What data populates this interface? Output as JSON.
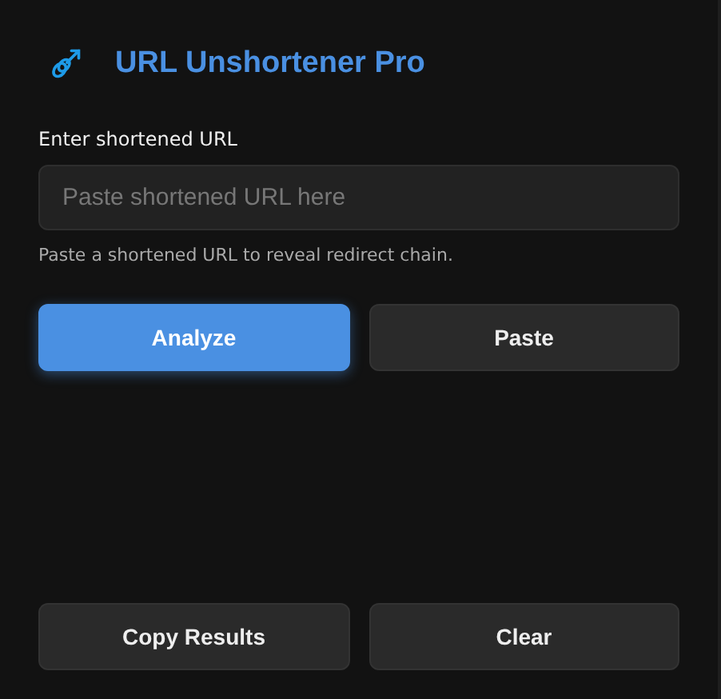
{
  "header": {
    "title": "URL Unshortener Pro"
  },
  "url_input": {
    "label": "Enter shortened URL",
    "placeholder": "Paste shortened URL here",
    "hint": "Paste a shortened URL to reveal redirect chain."
  },
  "actions": [
    {
      "label": "Analyze",
      "kind": "primary"
    },
    {
      "label": "Paste",
      "kind": "secondary"
    }
  ],
  "footer_actions": [
    {
      "label": "Copy Results"
    },
    {
      "label": "Clear"
    }
  ]
}
